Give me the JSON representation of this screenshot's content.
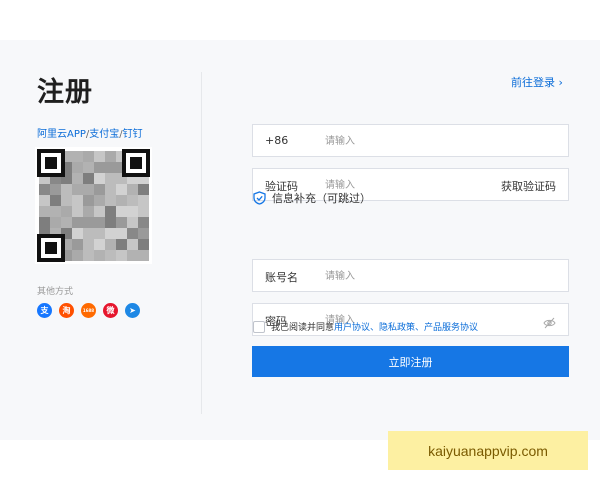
{
  "title": "注册",
  "qr": {
    "label_aliyun": "阿里云APP",
    "sep1": "/",
    "label_alipay": "支付宝",
    "sep2": "/",
    "label_dingtalk": "钉钉"
  },
  "other_methods": {
    "label": "其他方式",
    "icons": [
      {
        "name": "alipay-icon",
        "glyph": "支",
        "color": "#1677ff"
      },
      {
        "name": "taobao-icon",
        "glyph": "淘",
        "color": "#ff5000"
      },
      {
        "name": "1688-icon",
        "glyph": "1688",
        "color": "#ff6a00"
      },
      {
        "name": "weibo-icon",
        "glyph": "微",
        "color": "#e6162d"
      },
      {
        "name": "dingtalk-icon",
        "glyph": "➤",
        "color": "#1e88e5"
      }
    ]
  },
  "login_link": "前往登录 ›",
  "form": {
    "phone": {
      "prefix": "+86",
      "placeholder": "请输入"
    },
    "code": {
      "label": "验证码",
      "placeholder": "请输入",
      "action": "获取验证码"
    },
    "info_title": "信息补充（可跳过）",
    "account": {
      "label": "账号名",
      "placeholder": "请输入"
    },
    "password": {
      "label": "密码",
      "placeholder": "请输入"
    },
    "agree_text": "我已阅读并同意",
    "agree_links": "用户协议、隐私政策、产品服务协议",
    "submit_label": "立即注册"
  },
  "watermark": "kaiyuanappvip.com",
  "colors": {
    "accent": "#1677e5",
    "link": "#0a6cd8",
    "panel_bg": "#f7f8fa",
    "watermark_bg": "#fdf0a2"
  }
}
